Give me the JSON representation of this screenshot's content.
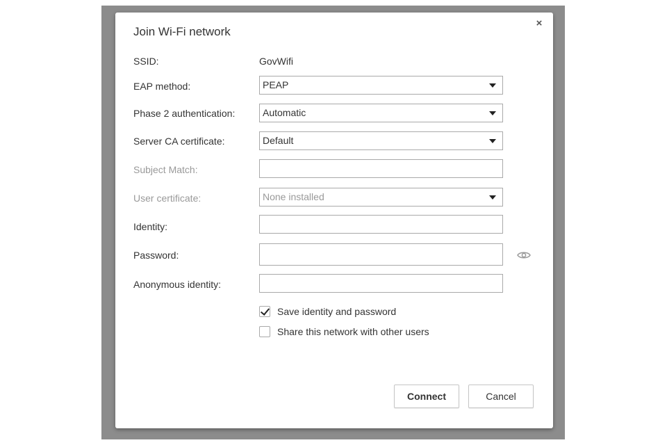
{
  "dialog": {
    "title": "Join Wi-Fi network",
    "close_glyph": "×"
  },
  "fields": {
    "ssid": {
      "label": "SSID:",
      "value": "GovWifi"
    },
    "eap_method": {
      "label": "EAP method:",
      "value": "PEAP"
    },
    "phase2": {
      "label": "Phase 2 authentication:",
      "value": "Automatic"
    },
    "server_ca": {
      "label": "Server CA certificate:",
      "value": "Default"
    },
    "subject_match": {
      "label": "Subject Match:",
      "value": ""
    },
    "user_cert": {
      "label": "User certificate:",
      "value": "None installed"
    },
    "identity": {
      "label": "Identity:",
      "value": ""
    },
    "password": {
      "label": "Password:",
      "value": ""
    },
    "anon_identity": {
      "label": "Anonymous identity:",
      "value": ""
    }
  },
  "checkboxes": {
    "save_identity": {
      "label": "Save identity and password",
      "checked": true
    },
    "share_network": {
      "label": "Share this network with other users",
      "checked": false
    }
  },
  "buttons": {
    "connect": "Connect",
    "cancel": "Cancel"
  },
  "icons": {
    "eye": "eye-icon"
  }
}
